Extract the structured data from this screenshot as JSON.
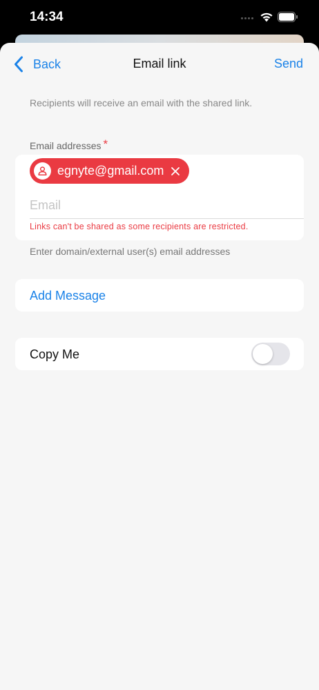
{
  "status_bar": {
    "time": "14:34"
  },
  "nav": {
    "back_label": "Back",
    "title": "Email link",
    "send_label": "Send"
  },
  "hint": "Recipients will receive an email with the shared link.",
  "email_field": {
    "label": "Email addresses",
    "required_mark": "*",
    "chips": [
      {
        "email": "egnyte@gmail.com",
        "icon": "person-icon",
        "status": "restricted"
      }
    ],
    "placeholder": "Email",
    "value": "",
    "error": "Links can't be shared as some recipients are restricted."
  },
  "helper": "Enter domain/external user(s) email addresses",
  "add_message": {
    "label": "Add Message"
  },
  "copy_me": {
    "label": "Copy Me",
    "enabled": false
  },
  "colors": {
    "accent": "#1a82e8",
    "error": "#ea3a42",
    "background": "#f6f6f6"
  }
}
